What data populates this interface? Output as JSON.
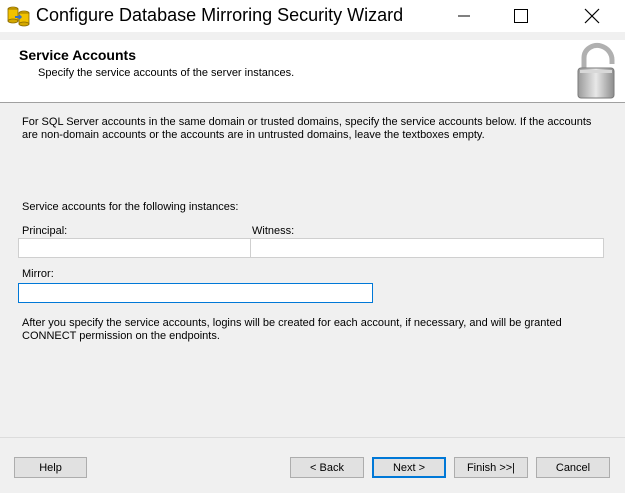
{
  "window": {
    "title": "Configure Database Mirroring Security Wizard",
    "app_icon": "database-wizard-icon",
    "controls": [
      "minimize-icon",
      "maximize-icon",
      "close-icon"
    ]
  },
  "header": {
    "title": "Service Accounts",
    "subtitle": "Specify the service accounts of the server instances.",
    "icon": "padlock-icon"
  },
  "body": {
    "description": "For SQL Server accounts in the same domain or trusted domains, specify the service accounts below. If the accounts are non-domain accounts or the accounts are in untrusted domains, leave the textboxes empty.",
    "instances_label": "Service accounts for the following instances:",
    "principal_label": "Principal:",
    "principal_value": "",
    "witness_label": "Witness:",
    "witness_value": "",
    "mirror_label": "Mirror:",
    "mirror_value": "",
    "after_text": "After you specify the service accounts, logins will be created for each account, if necessary, and will be granted CONNECT permission on the endpoints."
  },
  "buttons": {
    "help": "Help",
    "back": "< Back",
    "next": "Next >",
    "finish": "Finish >>|",
    "cancel": "Cancel"
  },
  "colors": {
    "accent": "#0078d7",
    "background": "#f0f0f0",
    "header_bg": "#ffffff"
  }
}
